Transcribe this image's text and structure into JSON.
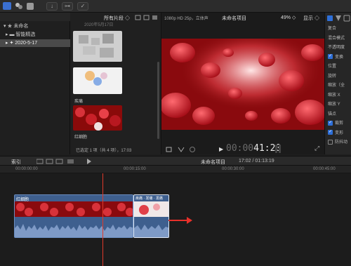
{
  "toolbar": {
    "icons": [
      "import-icon",
      "key-icon",
      "check-icon"
    ]
  },
  "library": {
    "root": "未命名",
    "items": [
      {
        "label": "智能精选"
      },
      {
        "label": "2020-5-17"
      }
    ]
  },
  "browser": {
    "filter_label": "所有片段 ◇",
    "date_header": "2020年5月17日",
    "clips": [
      {
        "label": ""
      },
      {
        "label": "疾痛"
      },
      {
        "label": "红细胞"
      }
    ],
    "status": "已选定 1 项（共 4 项），17:03"
  },
  "viewer": {
    "format": "1080p HD 25p，立体声",
    "project_name": "未命名项目",
    "zoom": "49% ◇",
    "display_label": "显示 ◇",
    "timecode_dim": "00:00",
    "timecode": "41:20"
  },
  "inspector": {
    "rows": [
      {
        "label": "复合",
        "check": ""
      },
      {
        "label": "混合模式",
        "check": ""
      },
      {
        "label": "不透明度",
        "check": ""
      },
      {
        "label": "变换",
        "check": "on"
      },
      {
        "label": "位置",
        "check": ""
      },
      {
        "label": "旋转",
        "check": ""
      },
      {
        "label": "缩放（全",
        "check": ""
      },
      {
        "label": "缩放 X",
        "check": ""
      },
      {
        "label": "缩放 Y",
        "check": ""
      },
      {
        "label": "锚点",
        "check": ""
      },
      {
        "label": "裁剪",
        "check": "on"
      },
      {
        "label": "变形",
        "check": "on"
      },
      {
        "label": "防抖动",
        "check": "off"
      }
    ]
  },
  "timeline": {
    "index_label": "索引",
    "project_name": "未命名项目",
    "duration": "17:02 / 01:13:19",
    "ruler_ticks": [
      "00:00:00:00",
      "00:00:15:00",
      "00:00:30:00",
      "00:00:45:00"
    ],
    "clip1_label": "红细胞",
    "clip2_label": "疾痛 · 发痛 · 发痛",
    "playhead_seconds": 17.03
  },
  "colors": {
    "accent": "#2e6fd8",
    "clip_blue": "#4a6fa0",
    "playhead": "#e03a2a",
    "arrow": "#e8302a"
  }
}
